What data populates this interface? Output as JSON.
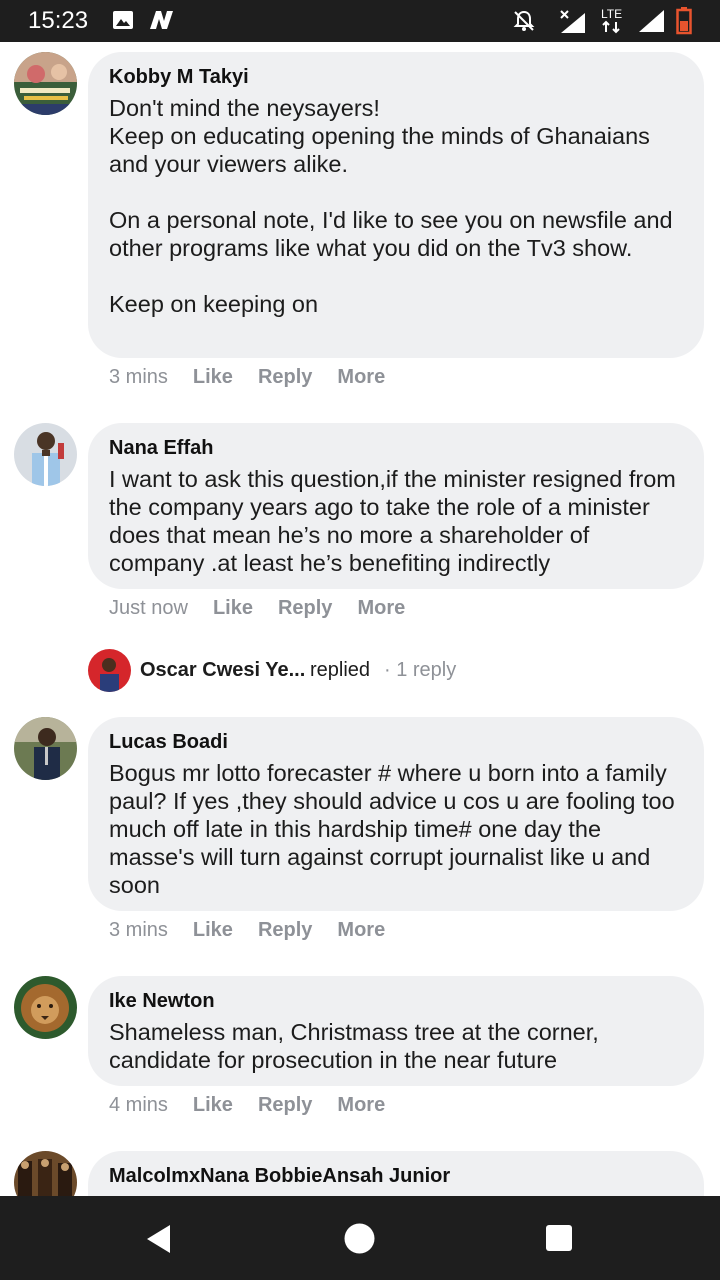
{
  "status_bar": {
    "time": "15:23",
    "network": "LTE"
  },
  "comments": [
    {
      "author": "Kobby M Takyi",
      "text": "Don't mind the neysayers!\nKeep on educating opening the minds of Ghanaians and your viewers alike.\n\nOn a personal note, I'd like to see you on newsfile and other programs like what you did on the Tv3 show.\n\nKeep on keeping on",
      "time": "3 mins",
      "like": "Like",
      "reply": "Reply",
      "more": "More"
    },
    {
      "author": "Nana Effah",
      "text": "I want to ask this question,if the minister resigned from the company years ago to take the role of a minister does that mean he’s no more a shareholder of company .at least he’s benefiting indirectly",
      "time": "Just now",
      "like": "Like",
      "reply": "Reply",
      "more": "More"
    },
    {
      "author": "Lucas Boadi",
      "text": "Bogus mr lotto forecaster # where u born into a family paul? If yes ,they should advice u cos u are fooling too much off late in this hardship time# one day the masse's will turn against corrupt journalist like u and soon",
      "time": "3 mins",
      "like": "Like",
      "reply": "Reply",
      "more": "More"
    },
    {
      "author": "Ike Newton",
      "text": "Shameless man, Christmass tree at the corner, candidate for prosecution in the near future",
      "time": "4 mins",
      "like": "Like",
      "reply": "Reply",
      "more": "More"
    },
    {
      "author": "MalcolmxNana BobbieAnsah Junior"
    }
  ],
  "reply_preview": {
    "name": "Oscar Cwesi Ye...",
    "text": "replied",
    "count": "· 1 reply"
  },
  "colors": {
    "bubble": "#eff0f2",
    "meta": "#8e9197",
    "bars": "#1e1e1e"
  }
}
